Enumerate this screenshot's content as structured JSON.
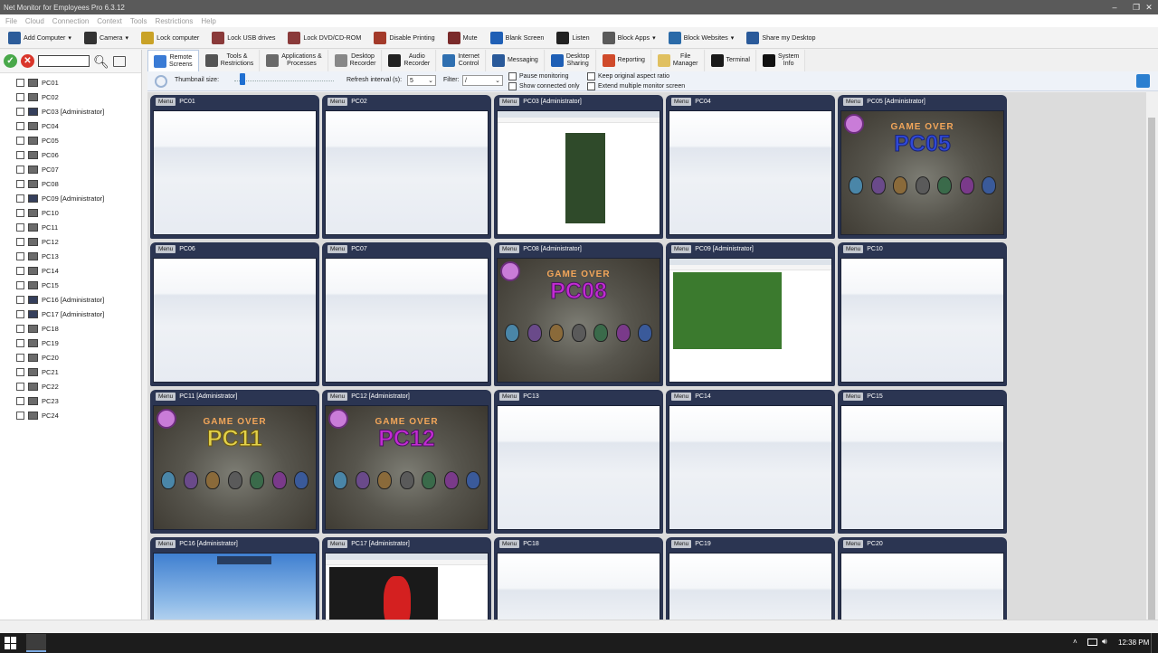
{
  "window": {
    "title": "Net Monitor for Employees Pro 6.3.12",
    "minimize": "–",
    "maximize": "❐",
    "close": "✕"
  },
  "menubar": [
    "File",
    "Cloud",
    "Connection",
    "Context",
    "Tools",
    "Restrictions",
    "Help"
  ],
  "toolbar": [
    {
      "label": "Add Computer",
      "icon": "add-computer-icon",
      "color": "#2c5c9a"
    },
    {
      "label": "Camera",
      "icon": "camera-icon",
      "color": "#333333"
    },
    {
      "label": "Lock computer",
      "icon": "lock-icon",
      "color": "#c9a227"
    },
    {
      "label": "Lock USB drives",
      "icon": "usb-lock-icon",
      "color": "#8a3a3a"
    },
    {
      "label": "Lock DVD/CD-ROM",
      "icon": "dvd-lock-icon",
      "color": "#8a3a3a"
    },
    {
      "label": "Disable Printing",
      "icon": "printer-icon",
      "color": "#a33a2a"
    },
    {
      "label": "Mute",
      "icon": "mute-icon",
      "color": "#7a2a2a"
    },
    {
      "label": "Blank Screen",
      "icon": "blank-screen-icon",
      "color": "#1f5fb5"
    },
    {
      "label": "Listen",
      "icon": "microphone-icon",
      "color": "#222222"
    },
    {
      "label": "Block Apps",
      "icon": "block-apps-icon",
      "color": "#5a5a5a"
    },
    {
      "label": "Block Websites",
      "icon": "block-websites-icon",
      "color": "#2a6aa8"
    },
    {
      "label": "Share my Desktop",
      "icon": "share-desktop-icon",
      "color": "#2a5a9a"
    }
  ],
  "sidebar": {
    "search_value": "",
    "items": [
      {
        "label": "PC01",
        "admin": false
      },
      {
        "label": "PC02",
        "admin": false
      },
      {
        "label": "PC03 [Administrator]",
        "admin": true
      },
      {
        "label": "PC04",
        "admin": false
      },
      {
        "label": "PC05",
        "admin": false
      },
      {
        "label": "PC06",
        "admin": false
      },
      {
        "label": "PC07",
        "admin": false
      },
      {
        "label": "PC08",
        "admin": false
      },
      {
        "label": "PC09 [Administrator]",
        "admin": true
      },
      {
        "label": "PC10",
        "admin": false
      },
      {
        "label": "PC11",
        "admin": false
      },
      {
        "label": "PC12",
        "admin": false
      },
      {
        "label": "PC13",
        "admin": false
      },
      {
        "label": "PC14",
        "admin": false
      },
      {
        "label": "PC15",
        "admin": false
      },
      {
        "label": "PC16 [Administrator]",
        "admin": true
      },
      {
        "label": "PC17 [Administrator]",
        "admin": true
      },
      {
        "label": "PC18",
        "admin": false
      },
      {
        "label": "PC19",
        "admin": false
      },
      {
        "label": "PC20",
        "admin": false
      },
      {
        "label": "PC21",
        "admin": false
      },
      {
        "label": "PC22",
        "admin": false
      },
      {
        "label": "PC23",
        "admin": false
      },
      {
        "label": "PC24",
        "admin": false
      }
    ]
  },
  "tabs": [
    {
      "line1": "Remote",
      "line2": "Screens",
      "icon": "remote-screens-icon",
      "color": "#3a7bd5",
      "active": true
    },
    {
      "line1": "Tools &",
      "line2": "Restrictions",
      "icon": "tools-icon",
      "color": "#555555"
    },
    {
      "line1": "Applications &",
      "line2": "Processes",
      "icon": "applications-icon",
      "color": "#6a6a6a"
    },
    {
      "line1": "Desktop",
      "line2": "Recorder",
      "icon": "desktop-recorder-icon",
      "color": "#888888"
    },
    {
      "line1": "Audio",
      "line2": "Recorder",
      "icon": "audio-recorder-icon",
      "color": "#222222"
    },
    {
      "line1": "Internet",
      "line2": "Control",
      "icon": "internet-control-icon",
      "color": "#2f6fb0"
    },
    {
      "line1": "Messaging",
      "line2": "",
      "icon": "messaging-icon",
      "color": "#2a5a9a"
    },
    {
      "line1": "Desktop",
      "line2": "Sharing",
      "icon": "desktop-sharing-icon",
      "color": "#1f5fb5"
    },
    {
      "line1": "Reporting",
      "line2": "",
      "icon": "reporting-icon",
      "color": "#d04a2a"
    },
    {
      "line1": "File",
      "line2": "Manager",
      "icon": "file-manager-icon",
      "color": "#e0c060"
    },
    {
      "line1": "Terminal",
      "line2": "",
      "icon": "terminal-icon",
      "color": "#1a1a1a"
    },
    {
      "line1": "System",
      "line2": "Info",
      "icon": "system-info-icon",
      "color": "#111111"
    }
  ],
  "options": {
    "thumbnail_label": "Thumbnail size:",
    "thumbnail_level": 0.05,
    "refresh_label": "Refresh interval (s):",
    "refresh_value": "5",
    "filter_label": "Filter:",
    "filter_value": "/",
    "pause_monitoring": "Pause monitoring",
    "show_connected_only": "Show connected only",
    "keep_aspect": "Keep original aspect ratio",
    "extend_monitor": "Extend multiple monitor screen"
  },
  "tiles": [
    {
      "name": "PC01",
      "kind": "empty"
    },
    {
      "name": "PC02",
      "kind": "empty"
    },
    {
      "name": "PC03 [Administrator]",
      "kind": "web"
    },
    {
      "name": "PC04",
      "kind": "empty"
    },
    {
      "name": "PC05 [Administrator]",
      "kind": "game",
      "game_label": "PC05",
      "color": "blue"
    },
    {
      "name": "PC06",
      "kind": "empty"
    },
    {
      "name": "PC07",
      "kind": "empty"
    },
    {
      "name": "PC08 [Administrator]",
      "kind": "game",
      "game_label": "PC08",
      "color": "purple"
    },
    {
      "name": "PC09 [Administrator]",
      "kind": "web"
    },
    {
      "name": "PC10",
      "kind": "empty"
    },
    {
      "name": "PC11 [Administrator]",
      "kind": "game",
      "game_label": "PC11",
      "color": "yellow"
    },
    {
      "name": "PC12 [Administrator]",
      "kind": "game",
      "game_label": "PC12",
      "color": "purple"
    },
    {
      "name": "PC13",
      "kind": "empty"
    },
    {
      "name": "PC14",
      "kind": "empty"
    },
    {
      "name": "PC15",
      "kind": "empty"
    },
    {
      "name": "PC16 [Administrator]",
      "kind": "sky"
    },
    {
      "name": "PC17 [Administrator]",
      "kind": "web"
    },
    {
      "name": "PC18",
      "kind": "empty"
    },
    {
      "name": "PC19",
      "kind": "empty"
    },
    {
      "name": "PC20",
      "kind": "empty"
    }
  ],
  "menu_label": "Menu",
  "game_over_text": "GAME OVER",
  "taskbar": {
    "time": "12:38 PM"
  }
}
